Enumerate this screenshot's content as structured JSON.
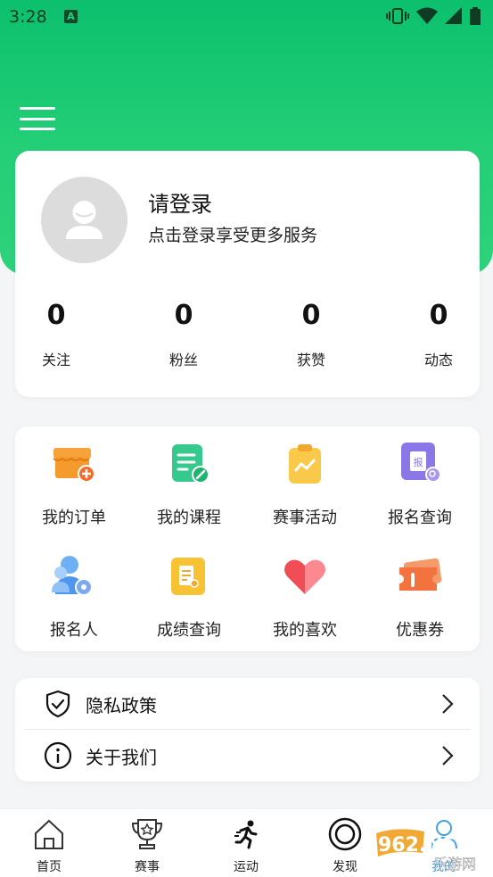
{
  "status_bar": {
    "time": "3:28",
    "notification_badge": "A",
    "icons": [
      "vibrate-icon",
      "wifi-icon",
      "signal-icon",
      "battery-icon"
    ]
  },
  "colors": {
    "header_green": "#1cc972",
    "card_bg": "#ffffff",
    "page_bg": "#f4f5f6",
    "text_primary": "#111111"
  },
  "header": {
    "menu_icon": "hamburger-menu-icon"
  },
  "profile": {
    "title": "请登录",
    "subtitle": "点击登录享受更多服务",
    "avatar_icon": "default-avatar-icon",
    "stats": [
      {
        "value": "0",
        "label": "关注"
      },
      {
        "value": "0",
        "label": "粉丝"
      },
      {
        "value": "0",
        "label": "获赞"
      },
      {
        "value": "0",
        "label": "动态"
      }
    ]
  },
  "features": [
    {
      "label": "我的订单",
      "icon": "shop-order-icon"
    },
    {
      "label": "我的课程",
      "icon": "course-icon"
    },
    {
      "label": "赛事活动",
      "icon": "event-activity-icon"
    },
    {
      "label": "报名查询",
      "icon": "registration-search-icon"
    },
    {
      "label": "报名人",
      "icon": "registrant-icon"
    },
    {
      "label": "成绩查询",
      "icon": "score-query-icon"
    },
    {
      "label": "我的喜欢",
      "icon": "heart-icon"
    },
    {
      "label": "优惠券",
      "icon": "coupon-icon"
    }
  ],
  "settings": [
    {
      "label": "隐私政策",
      "icon": "shield-check-icon"
    },
    {
      "label": "关于我们",
      "icon": "info-icon"
    }
  ],
  "tabbar": [
    {
      "label": "首页",
      "icon": "home-icon"
    },
    {
      "label": "赛事",
      "icon": "trophy-icon"
    },
    {
      "label": "运动",
      "icon": "running-icon"
    },
    {
      "label": "发现",
      "icon": "discover-icon"
    },
    {
      "label": "我的",
      "icon": "profile-icon"
    }
  ],
  "watermark": {
    "top": "962.NET",
    "bottom": "乐游网"
  }
}
